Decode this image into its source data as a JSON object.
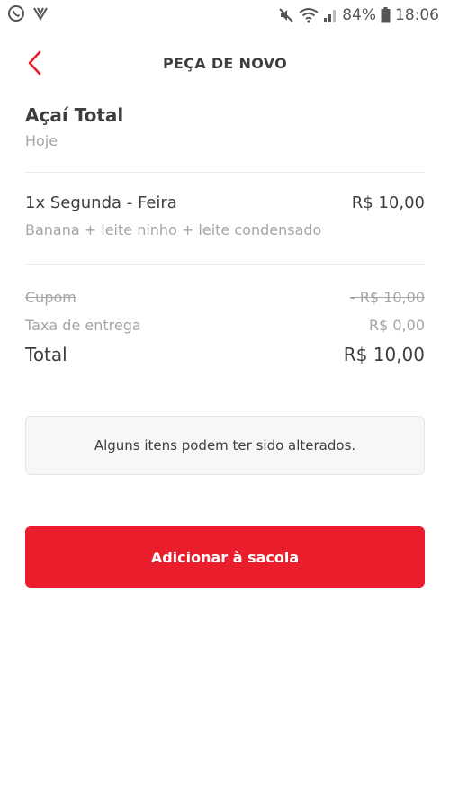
{
  "status_bar": {
    "battery": "84%",
    "time": "18:06",
    "icons": [
      "whatsapp-icon",
      "notification-icon",
      "mute-icon",
      "wifi-icon",
      "signal-icon",
      "battery-icon"
    ]
  },
  "header": {
    "back_icon": "chevron-left-icon",
    "title": "PEÇA DE NOVO"
  },
  "store": {
    "name": "Açaí Total",
    "date": "Hoje"
  },
  "item": {
    "title": "1x Segunda - Feira",
    "price": "R$ 10,00",
    "description": "Banana + leite ninho + leite condensado"
  },
  "summary": {
    "coupon_label": "Cupom",
    "coupon_value": "- R$ 10,00",
    "delivery_label": "Taxa de entrega",
    "delivery_value": "R$ 0,00",
    "total_label": "Total",
    "total_value": "R$ 10,00"
  },
  "notice": "Alguns itens podem ter sido alterados.",
  "add_button": "Adicionar à sacola",
  "colors": {
    "accent": "#ea1d2c",
    "text": "#3f3e3e",
    "muted": "#a6a5a5"
  }
}
